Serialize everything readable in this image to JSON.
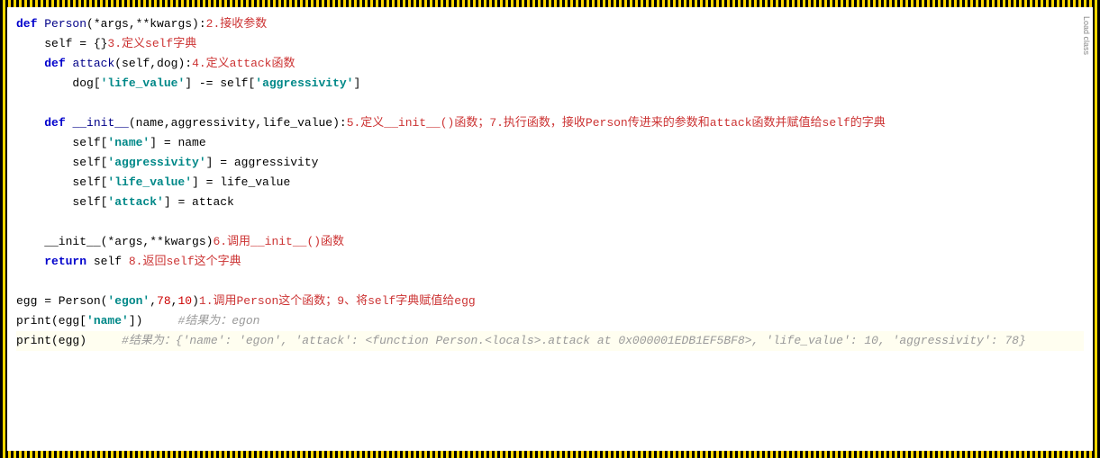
{
  "sidebar_label": "Load class",
  "lines": {
    "l1_kw_def": "def",
    "l1_fn": "Person",
    "l1_rest": "(*args,**kwargs):",
    "l1_annot": "2.接收参数",
    "l2_pre": "    self = {}",
    "l2_annot": "3.定义self字典",
    "l3_kw_def": "def",
    "l3_fn": "attack",
    "l3_rest": "(self,dog):",
    "l3_indent": "    ",
    "l3_annot": "4.定义attack函数",
    "l4_indent": "        dog[",
    "l4_str1": "'life_value'",
    "l4_mid": "] -= self[",
    "l4_str2": "'aggressivity'",
    "l4_end": "]",
    "l5_indent": "    ",
    "l5_kw_def": "def",
    "l5_fn": "__init__",
    "l5_rest": "(name,aggressivity,life_value):",
    "l5_annot": "5.定义__init__()函数；7.执行函数，接收Person传进来的参数和attack函数并赋值给self的字典",
    "l6_indent": "        self[",
    "l6_str": "'name'",
    "l6_rest": "] = name",
    "l7_indent": "        self[",
    "l7_str": "'aggressivity'",
    "l7_rest": "] = aggressivity",
    "l8_indent": "        self[",
    "l8_str": "'life_value'",
    "l8_rest": "] = life_value",
    "l9_indent": "        self[",
    "l9_str": "'attack'",
    "l9_rest": "] = attack",
    "l10_text": "    __init__(*args,**kwargs)",
    "l10_annot": "6.调用__init__()函数",
    "l11_indent": "    ",
    "l11_kw": "return",
    "l11_rest": " self ",
    "l11_annot": "8.返回self这个字典",
    "l12_pre": "egg = Person(",
    "l12_str": "'egon'",
    "l12_num1": "78",
    "l12_num2": "10",
    "l12_c1": ",",
    "l12_c2": ",",
    "l12_end": ")",
    "l12_annot": "1.调用Person这个函数；9、将self字典赋值给egg",
    "l13_pre": "print(egg[",
    "l13_str": "'name'",
    "l13_end": "])     ",
    "l13_cmt": "#结果为：egon",
    "l14_pre": "print(egg)     ",
    "l14_cmt": "#结果为：{'name': 'egon', 'attack': <function Person.<locals>.attack at 0x000001EDB1EF5BF8>, 'life_value': 10, 'aggressivity': 78}"
  }
}
